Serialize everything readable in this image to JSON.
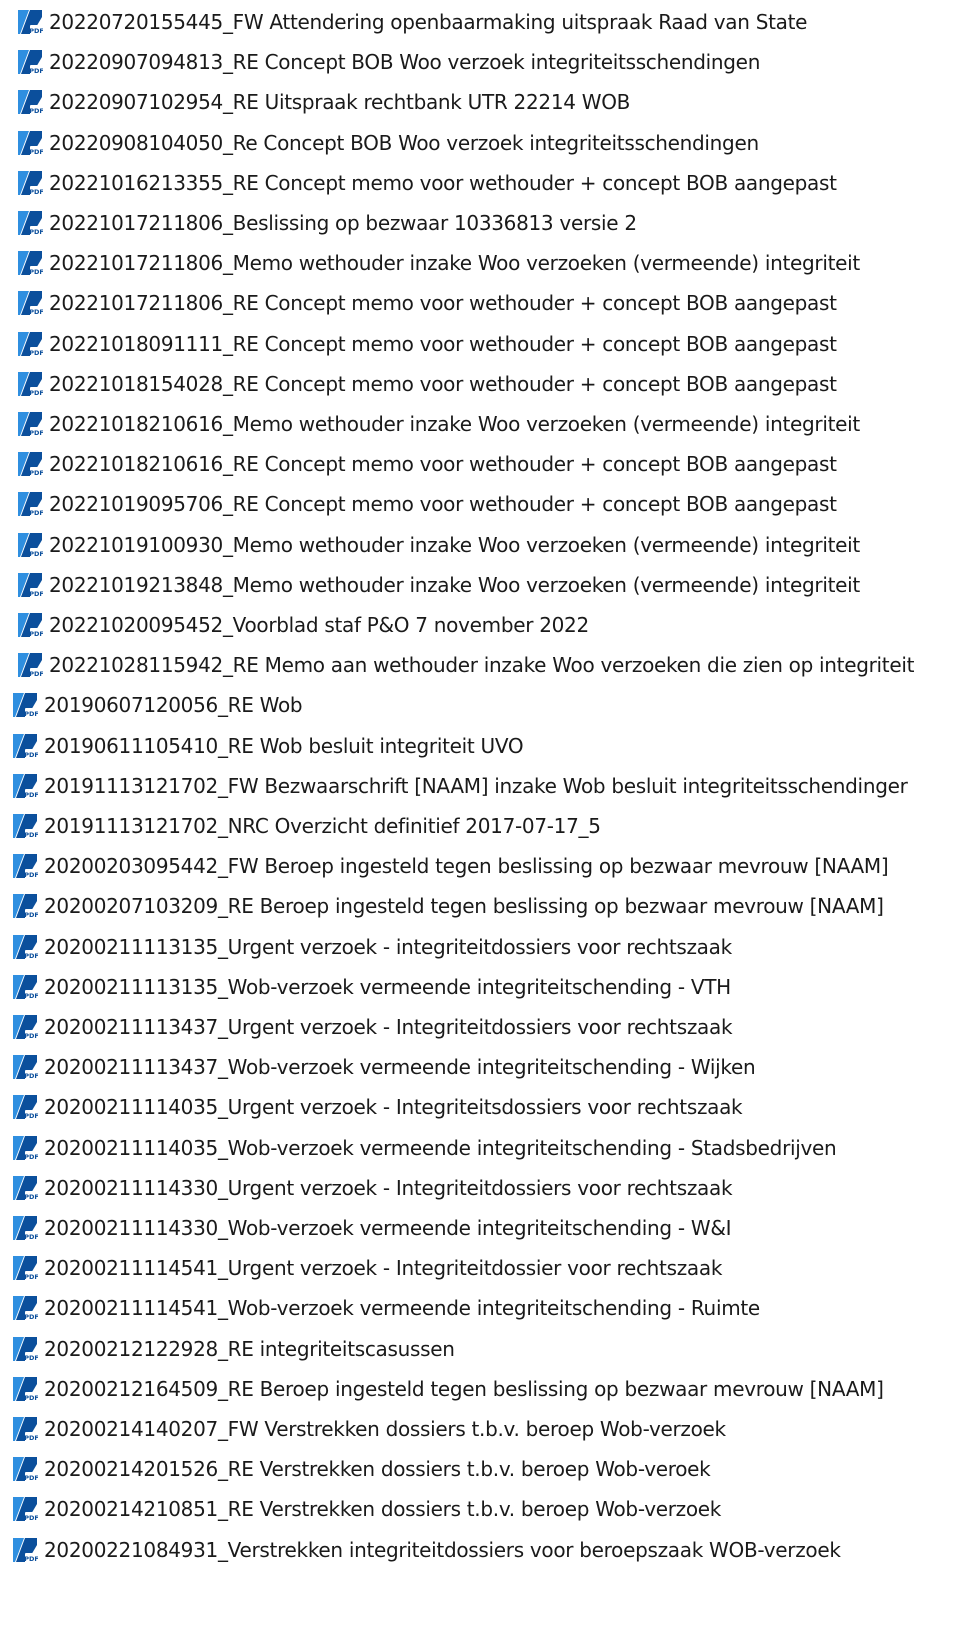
{
  "icon": "pdf-file-icon",
  "icon_colors": {
    "blue_dark": "#0b4f9c",
    "blue_light": "#2f8fe0",
    "badge": "#ffffff",
    "badge_text": "#0b4f9c"
  },
  "file_list": [
    {
      "name": "20220720155445_FW Attendering openbaarmaking uitspraak Raad van State"
    },
    {
      "name": "20220907094813_RE Concept BOB Woo verzoek integriteitsschendingen"
    },
    {
      "name": "20220907102954_RE Uitspraak rechtbank UTR 22214 WOB"
    },
    {
      "name": "20220908104050_Re Concept BOB Woo verzoek integriteitsschendingen"
    },
    {
      "name": "20221016213355_RE Concept memo voor wethouder + concept BOB aangepast"
    },
    {
      "name": "20221017211806_Beslissing op bezwaar 10336813 versie 2"
    },
    {
      "name": "20221017211806_Memo wethouder inzake Woo verzoeken (vermeende) integriteit"
    },
    {
      "name": "20221017211806_RE Concept memo voor wethouder + concept BOB aangepast"
    },
    {
      "name": "20221018091111_RE Concept memo voor wethouder + concept BOB aangepast"
    },
    {
      "name": "20221018154028_RE Concept memo voor wethouder + concept BOB aangepast"
    },
    {
      "name": "20221018210616_Memo wethouder inzake Woo verzoeken (vermeende) integriteit"
    },
    {
      "name": "20221018210616_RE Concept memo voor wethouder + concept BOB aangepast"
    },
    {
      "name": "20221019095706_RE Concept memo voor wethouder + concept BOB aangepast"
    },
    {
      "name": "20221019100930_Memo wethouder inzake Woo verzoeken (vermeende) integriteit"
    },
    {
      "name": "20221019213848_Memo wethouder inzake Woo verzoeken (vermeende) integriteit"
    },
    {
      "name": "20221020095452_Voorblad staf P&O 7 november 2022"
    },
    {
      "name": "20221028115942_RE Memo aan wethouder inzake Woo verzoeken die zien op integriteit"
    },
    {
      "name": "20190607120056_RE Wob"
    },
    {
      "name": "20190611105410_RE Wob besluit integriteit UVO"
    },
    {
      "name": "20191113121702_FW Bezwaarschrift [NAAM] inzake Wob besluit integriteitsschendinger"
    },
    {
      "name": "20191113121702_NRC Overzicht definitief 2017-07-17_5"
    },
    {
      "name": "20200203095442_FW Beroep ingesteld tegen beslissing op bezwaar mevrouw [NAAM]"
    },
    {
      "name": "20200207103209_RE Beroep ingesteld tegen beslissing op bezwaar mevrouw [NAAM]"
    },
    {
      "name": "20200211113135_Urgent verzoek - integriteitdossiers voor rechtszaak"
    },
    {
      "name": "20200211113135_Wob-verzoek vermeende integriteitschending - VTH"
    },
    {
      "name": "20200211113437_Urgent verzoek - Integriteitdossiers voor rechtszaak"
    },
    {
      "name": "20200211113437_Wob-verzoek vermeende integriteitschending - Wijken"
    },
    {
      "name": "20200211114035_Urgent verzoek - Integriteitsdossiers voor rechtszaak"
    },
    {
      "name": "20200211114035_Wob-verzoek vermeende integriteitschending - Stadsbedrijven"
    },
    {
      "name": "20200211114330_Urgent verzoek - Integriteitdossiers voor rechtszaak"
    },
    {
      "name": "20200211114330_Wob-verzoek vermeende integriteitschending - W&I"
    },
    {
      "name": "20200211114541_Urgent verzoek - Integriteitdossier voor rechtszaak"
    },
    {
      "name": "20200211114541_Wob-verzoek vermeende integriteitschending - Ruimte"
    },
    {
      "name": "20200212122928_RE integriteitscasussen"
    },
    {
      "name": "20200212164509_RE Beroep ingesteld tegen beslissing op bezwaar mevrouw [NAAM]"
    },
    {
      "name": "20200214140207_FW Verstrekken dossiers t.b.v. beroep Wob-verzoek"
    },
    {
      "name": "20200214201526_RE Verstrekken dossiers t.b.v. beroep Wob-veroek"
    },
    {
      "name": "20200214210851_RE Verstrekken dossiers t.b.v. beroep Wob-verzoek"
    },
    {
      "name": "20200221084931_Verstrekken integriteitdossiers voor beroepszaak WOB-verzoek"
    }
  ]
}
